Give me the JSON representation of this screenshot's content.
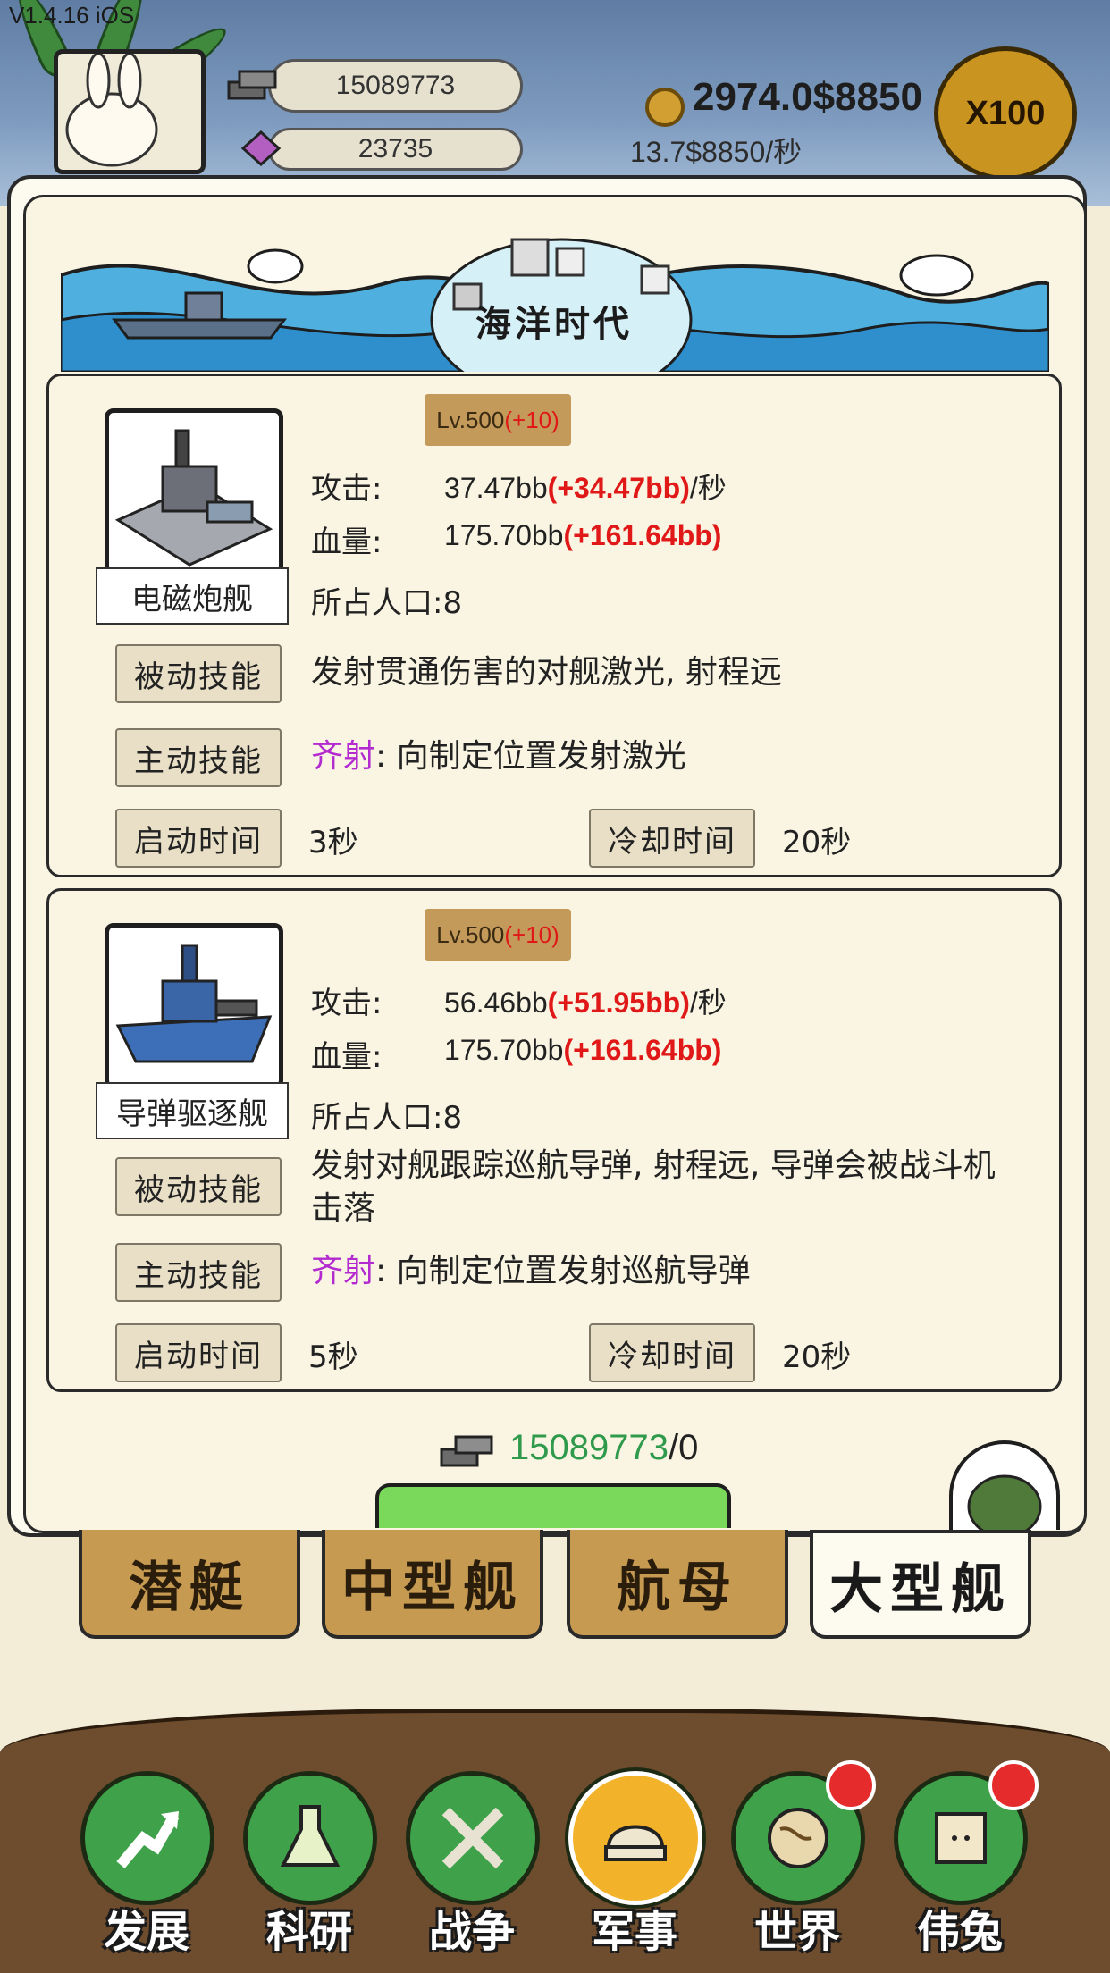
{
  "hud": {
    "version": "V1.4.16 iOS",
    "resource_top": "15089773",
    "resource_bottom": "23735",
    "coins": "2974.0$8850",
    "coin_rate": "13.7$8850/秒",
    "multiplier": "X100"
  },
  "panel": {
    "era_title": "海洋时代"
  },
  "units": [
    {
      "name": "电磁炮舰",
      "level": "Lv.500",
      "level_bonus": "(+10)",
      "attack_label": "攻击:",
      "attack_value": "37.47bb",
      "attack_bonus": "(+34.47bb)",
      "attack_unit": "/秒",
      "hp_label": "血量:",
      "hp_value": "175.70bb",
      "hp_bonus": "(+161.64bb)",
      "population": "所占人口:8",
      "passive_label": "被动技能",
      "passive_text": "发射贯通伤害的对舰激光, 射程远",
      "active_label": "主动技能",
      "active_name": "齐射",
      "active_text": ": 向制定位置发射激光",
      "startup_label": "启动时间",
      "startup_value": "3秒",
      "cooldown_label": "冷却时间",
      "cooldown_value": "20秒"
    },
    {
      "name": "导弹驱逐舰",
      "level": "Lv.500",
      "level_bonus": "(+10)",
      "attack_label": "攻击:",
      "attack_value": "56.46bb",
      "attack_bonus": "(+51.95bb)",
      "attack_unit": "/秒",
      "hp_label": "血量:",
      "hp_value": "175.70bb",
      "hp_bonus": "(+161.64bb)",
      "population": "所占人口:8",
      "passive_label": "被动技能",
      "passive_text": "发射对舰跟踪巡航导弹, 射程远, 导弹会被战斗机击落",
      "active_label": "主动技能",
      "active_name": "齐射",
      "active_text": ": 向制定位置发射巡航导弹",
      "startup_label": "启动时间",
      "startup_value": "5秒",
      "cooldown_label": "冷却时间",
      "cooldown_value": "20秒"
    }
  ],
  "cost": {
    "owned": "15089773",
    "required": "/0"
  },
  "categories": [
    {
      "label": "潜艇",
      "active": false
    },
    {
      "label": "中型舰",
      "active": false
    },
    {
      "label": "航母",
      "active": false
    },
    {
      "label": "大型舰",
      "active": true
    }
  ],
  "nav": [
    {
      "label": "发展",
      "icon": "development-icon",
      "badge": false
    },
    {
      "label": "科研",
      "icon": "flask-icon",
      "badge": false
    },
    {
      "label": "战争",
      "icon": "crossed-swords-icon",
      "badge": false
    },
    {
      "label": "军事",
      "icon": "military-hat-icon",
      "badge": false,
      "active": true
    },
    {
      "label": "世界",
      "icon": "globe-icon",
      "badge": true
    },
    {
      "label": "伟兔",
      "icon": "rabbit-portrait-icon",
      "badge": true
    }
  ],
  "colors": {
    "accent_red": "#e01818",
    "skill_purple": "#b32bd0",
    "cost_green": "#2f9a4c",
    "tab_gold": "#c79a52",
    "nav_green": "#3fa24a",
    "nav_active": "#f2b32b"
  }
}
